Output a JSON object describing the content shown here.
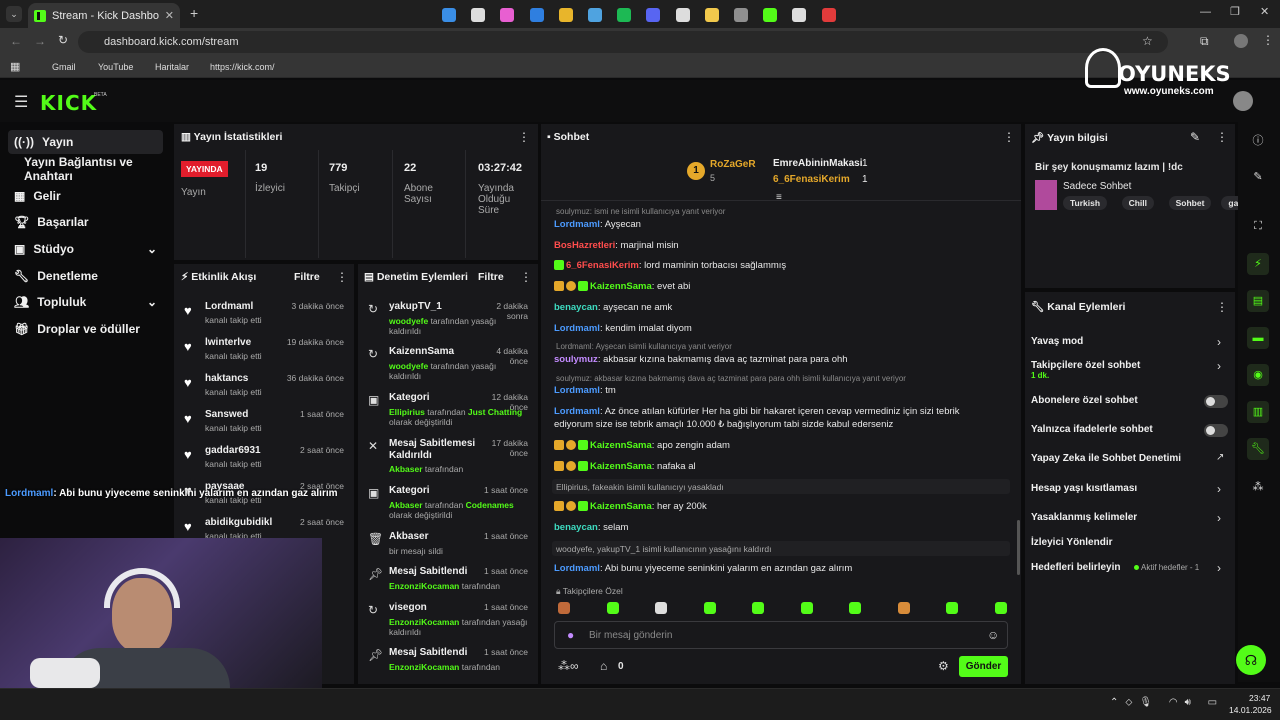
{
  "browser": {
    "tab_title": "Stream - Kick Dashboard",
    "url": "dashboard.kick.com/stream",
    "bookmarks": [
      "Gmail",
      "YouTube",
      "Haritalar",
      "https://kick.com/"
    ]
  },
  "brand": {
    "logo": "KICK",
    "beta": "BETA",
    "watermark": "OYUNEKS",
    "watermark_url": "www.oyuneks.com"
  },
  "sidebar": {
    "items": [
      {
        "label": "Yayın",
        "icon": "broadcast-icon"
      },
      {
        "label": "Yayın Bağlantısı ve Anahtarı"
      },
      {
        "label": "Gelir",
        "icon": "income-icon"
      },
      {
        "label": "Başarılar",
        "icon": "trophy-icon"
      },
      {
        "label": "Stüdyo",
        "icon": "studio-icon"
      },
      {
        "label": "Denetleme",
        "icon": "wrench-icon"
      },
      {
        "label": "Topluluk",
        "icon": "community-icon"
      },
      {
        "label": "Droplar ve ödüller",
        "icon": "gift-icon"
      }
    ]
  },
  "stats": {
    "title": "Yayın İstatistikleri",
    "live_badge": "YAYINDA",
    "live_label": "Yayın",
    "items": [
      {
        "value": "19",
        "label": "İzleyici"
      },
      {
        "value": "779",
        "label": "Takipçi"
      },
      {
        "value": "22",
        "label": "Abone Sayısı"
      },
      {
        "value": "03:27:42",
        "label": "Yayında Olduğu Süre"
      }
    ]
  },
  "activity": {
    "title": "Etkinlik Akışı",
    "filter": "Filtre",
    "items": [
      {
        "name": "Lordmaml",
        "sub": "kanalı takip etti",
        "time": "3 dakika önce"
      },
      {
        "name": "lwinterlve",
        "sub": "kanalı takip etti",
        "time": "19 dakika önce"
      },
      {
        "name": "haktancs",
        "sub": "kanalı takip etti",
        "time": "36 dakika önce"
      },
      {
        "name": "Sanswed",
        "sub": "kanalı takip etti",
        "time": "1 saat önce"
      },
      {
        "name": "gaddar6931",
        "sub": "kanalı takip etti",
        "time": "2 saat önce"
      },
      {
        "name": "paysaae",
        "sub": "kanalı takip etti",
        "time": "2 saat önce"
      },
      {
        "name": "abidikgubidikl",
        "sub": "kanalı takip etti",
        "time": "2 saat önce"
      }
    ]
  },
  "overlay_chat": {
    "user": "Lordmaml",
    "text": ": Abi bunu yiyeceme seninkini yalarım en azından gaz alırım"
  },
  "modlog": {
    "title": "Denetim Eylemleri",
    "filter": "Filtre",
    "items": [
      {
        "title": "yakupTV_1",
        "actor": "woodyefe",
        "desc": " tarafından yasağı kaldırıldı",
        "time": "2 dakika sonra"
      },
      {
        "title": "KaizennSama",
        "actor": "woodyefe",
        "desc": " tarafından yasağı kaldırıldı",
        "time": "4 dakika önce"
      },
      {
        "title": "Kategori",
        "actor": "Ellipirius",
        "desc": " tarafından ",
        "extra": "Just Chatting",
        "desc2": " olarak değiştirildi",
        "time": "12 dakika önce"
      },
      {
        "title": "Mesaj Sabitlemesi Kaldırıldı",
        "actor": "Akbaser",
        "desc": " tarafından",
        "time": "17 dakika önce"
      },
      {
        "title": "Kategori",
        "actor": "Akbaser",
        "desc": " tarafından ",
        "extra": "Codenames",
        "desc2": " olarak değiştirildi",
        "time": "1 saat önce"
      },
      {
        "title": "Akbaser",
        "actor": "",
        "desc": "bir mesajı sildi",
        "time": "1 saat önce"
      },
      {
        "title": "Mesaj Sabitlendi",
        "actor": "EnzonziKocaman",
        "desc": " tarafından",
        "time": "1 saat önce"
      },
      {
        "title": "visegon",
        "actor": "EnzonziKocaman",
        "desc": " tarafından yasağı kaldırıldı",
        "time": "1 saat önce"
      },
      {
        "title": "Mesaj Sabitlendi",
        "actor": "EnzonziKocaman",
        "desc": " tarafından",
        "time": "1 saat önce"
      }
    ]
  },
  "chat": {
    "title": "Sohbet",
    "top": {
      "rank": "1",
      "name": "RoZaGeR",
      "count": "5",
      "gifters": [
        {
          "name": "EmreAbininMakasi",
          "count": "1"
        },
        {
          "name": "6_6FenasiKerim",
          "count": "1"
        }
      ]
    },
    "messages": [
      {
        "type": "reply",
        "text": "soulymuz: ismi ne isimli kullanıcıya yanıt veriyor"
      },
      {
        "user": "Lordmaml",
        "color": "blue",
        "text": ": Ayşecan"
      },
      {
        "user": "BosHazretleri",
        "color": "red",
        "text": ": marjinal misin"
      },
      {
        "user": "6_6FenasiKerim",
        "color": "red",
        "text": ": lord maminin torbacısı sağlammış",
        "badges": [
          "sub"
        ]
      },
      {
        "user": "KaizennSama",
        "color": "green",
        "text": ": evet abi",
        "badges": [
          "crown",
          "coin",
          "sub"
        ]
      },
      {
        "user": "benaycan",
        "color": "teal",
        "text": ": ayşecan ne amk"
      },
      {
        "user": "Lordmaml",
        "color": "blue",
        "text": ": kendim imalat diyom"
      },
      {
        "type": "reply",
        "text": "Lordmaml: Ayşecan isimli kullanıcıya yanıt veriyor"
      },
      {
        "user": "soulymuz",
        "color": "purple",
        "text": ": akbasar kızına bakmamış dava aç tazminat para para ohh"
      },
      {
        "type": "reply",
        "text": "soulymuz: akbasar kızına bakmamış dava aç tazminat para para ohh isimli kullanıcıya yanıt veriyor"
      },
      {
        "user": "Lordmaml",
        "color": "blue",
        "text": ": tm"
      },
      {
        "user": "Lordmaml",
        "color": "blue",
        "text": ": Az önce atılan küfürler Her ha gibi bir hakaret içeren cevap vermediniz için sizi tebrik ediyorum size ise tebrik amaçlı 10.000 ₺ bağışlıyorum tabi sizde kabul ederseniz"
      },
      {
        "user": "KaizennSama",
        "color": "green",
        "text": ": apo zengin adam",
        "badges": [
          "crown",
          "coin",
          "sub"
        ]
      },
      {
        "user": "KaizennSama",
        "color": "green",
        "text": ": nafaka al",
        "badges": [
          "crown",
          "coin",
          "sub"
        ]
      },
      {
        "type": "system",
        "text": "Ellipirius, fakeakin isimli kullanıcıyı yasakladı"
      },
      {
        "user": "KaizennSama",
        "color": "green",
        "text": ": her ay 200k",
        "badges": [
          "crown",
          "coin",
          "sub"
        ]
      },
      {
        "user": "benaycan",
        "color": "teal",
        "text": ": selam"
      },
      {
        "type": "system",
        "text": "woodyefe, yakupTV_1 isimli kullanıcının yasağını kaldırdı"
      },
      {
        "user": "Lordmaml",
        "color": "blue",
        "text": ": Abi bunu yiyeceme seninkini yalarım en azından gaz alırım"
      }
    ],
    "followers_only": "Takipçilere Özel",
    "input_placeholder": "Bir mesaj gönderin",
    "points": "0",
    "send": "Gönder"
  },
  "stream_info": {
    "title": "Yayın bilgisi",
    "stream_title": "Bir şey konuşmamız lazım | !dc",
    "category": "Sadece Sohbet",
    "tags": [
      "Turkish",
      "Chill",
      "Sohbet",
      "gaming"
    ]
  },
  "channel_actions": {
    "title": "Kanal Eylemleri",
    "items": [
      {
        "label": "Yavaş mod",
        "control": "chevron"
      },
      {
        "label": "Takipçilere özel sohbet",
        "sub": "1 dk.",
        "control": "chevron"
      },
      {
        "label": "Abonelere özel sohbet",
        "control": "toggle"
      },
      {
        "label": "Yalnızca ifadelerle sohbet",
        "control": "toggle"
      },
      {
        "label": "Yapay Zeka ile Sohbet Denetimi",
        "control": "external"
      },
      {
        "label": "Hesap yaşı kısıtlaması",
        "control": "chevron"
      },
      {
        "label": "Yasaklanmış kelimeler",
        "control": "chevron"
      },
      {
        "label": "İzleyici Yönlendir",
        "control": "none"
      },
      {
        "label": "Hedefleri belirleyin",
        "status": "Aktif hedefler - 1",
        "control": "chevron"
      }
    ]
  },
  "taskbar": {
    "time": "23:47",
    "date": "14.01.2026"
  }
}
